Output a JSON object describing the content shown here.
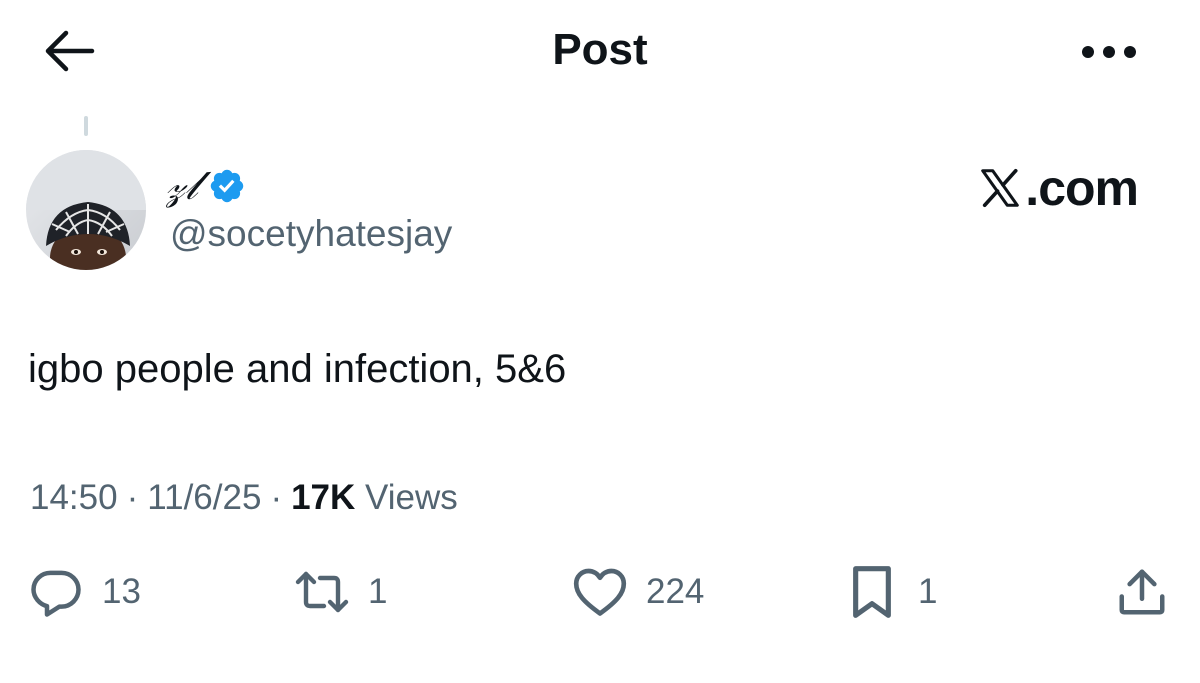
{
  "header": {
    "title": "Post",
    "back_icon": "arrow-left-icon",
    "more_icon": "more-horizontal-icon"
  },
  "author": {
    "display_name": "𝓏𝓁",
    "handle": "@socetyhatesjay",
    "verified": true,
    "verified_color": "#1d9bf0"
  },
  "watermark": {
    "text": ".com",
    "logo": "x-logo-icon"
  },
  "post": {
    "text": "igbo people and infection, 5&6",
    "time": "14:50",
    "date": "11/6/25",
    "views_count": "17K",
    "views_label": "Views",
    "separator": "·"
  },
  "actions": {
    "replies": "13",
    "reposts": "1",
    "likes": "224",
    "bookmarks": "1"
  },
  "colors": {
    "text_primary": "#0f1419",
    "text_secondary": "#536471",
    "accent": "#1d9bf0",
    "thread_line": "#cfd9de"
  }
}
